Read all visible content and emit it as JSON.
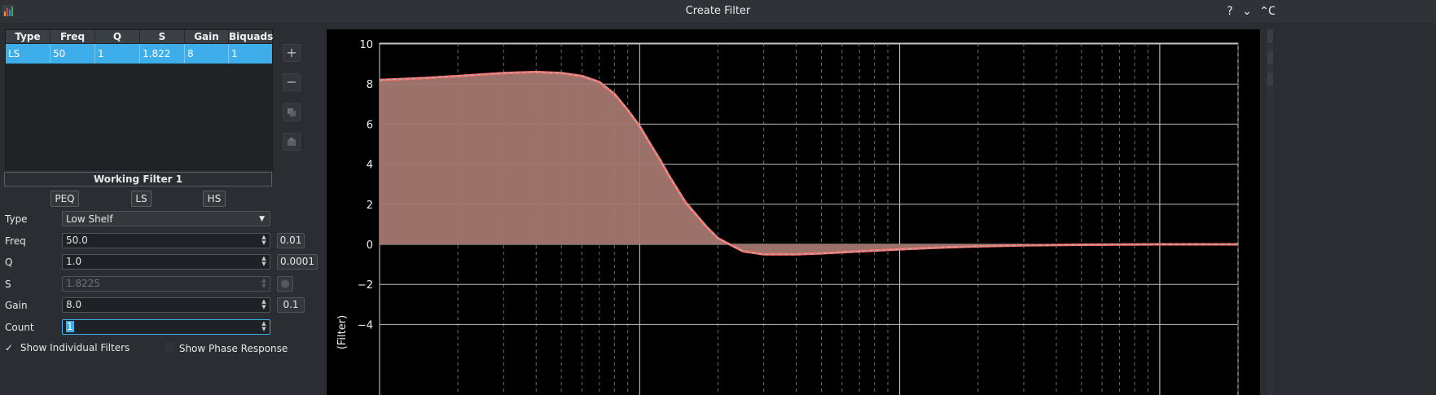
{
  "window": {
    "title": "Create Filter",
    "help": "?",
    "minimize": "⌄",
    "maximize": "⌃",
    "close": "C"
  },
  "table": {
    "headers": [
      "Type",
      "Freq",
      "Q",
      "S",
      "Gain",
      "Biquads"
    ],
    "rows": [
      [
        "LS",
        "50",
        "1",
        "1.822",
        "8",
        "1"
      ]
    ],
    "side_buttons": [
      "add-icon",
      "remove-icon",
      "copy-icon",
      "import-icon"
    ]
  },
  "working_filter": {
    "title": "Working Filter 1",
    "preset_buttons": [
      "PEQ",
      "LS",
      "HS"
    ],
    "type": {
      "label": "Type",
      "value": "Low Shelf"
    },
    "freq": {
      "label": "Freq",
      "value": "50.0",
      "step": "0.01"
    },
    "q": {
      "label": "Q",
      "value": "1.0",
      "step": "0.0001"
    },
    "s": {
      "label": "S",
      "value": "1.8225"
    },
    "gain": {
      "label": "Gain",
      "value": "8.0",
      "step": "0.1"
    },
    "count": {
      "label": "Count",
      "value": "1"
    },
    "show_individual": {
      "label": "Show Individual Filters",
      "checked": true,
      "mark": "✓"
    },
    "show_phase": {
      "label": "Show Phase Response",
      "checked": false
    }
  },
  "chart_data": {
    "type": "area",
    "ylabel": "(Filter)",
    "ylim": [
      -4.5,
      10
    ],
    "yticks": [
      10,
      8,
      6,
      4,
      2,
      0,
      -2,
      -4
    ],
    "ytick_labels": [
      "10",
      "8",
      "6",
      "4",
      "2",
      "0",
      "−2",
      "−4"
    ],
    "x_scale": "log",
    "xlim": [
      10,
      20000
    ],
    "grid": true,
    "series": [
      {
        "x": [
          10,
          15,
          20,
          30,
          40,
          50,
          60,
          70,
          80,
          90,
          100,
          110,
          120,
          130,
          150,
          180,
          200,
          250,
          300,
          400,
          500,
          700,
          1000,
          1500,
          2000,
          3000,
          5000,
          10000,
          20000
        ],
        "y": [
          8.2,
          8.3,
          8.4,
          8.55,
          8.6,
          8.55,
          8.4,
          8.1,
          7.5,
          6.7,
          5.9,
          5.0,
          4.2,
          3.4,
          2.1,
          0.9,
          0.3,
          -0.35,
          -0.5,
          -0.5,
          -0.45,
          -0.35,
          -0.25,
          -0.15,
          -0.1,
          -0.05,
          -0.02,
          0.0,
          0.0
        ],
        "color": "#ff6f6a"
      }
    ],
    "colors": {
      "fill": "#a3776f",
      "line": "#ff6f6a",
      "line_dash": "#87c4c3"
    }
  }
}
